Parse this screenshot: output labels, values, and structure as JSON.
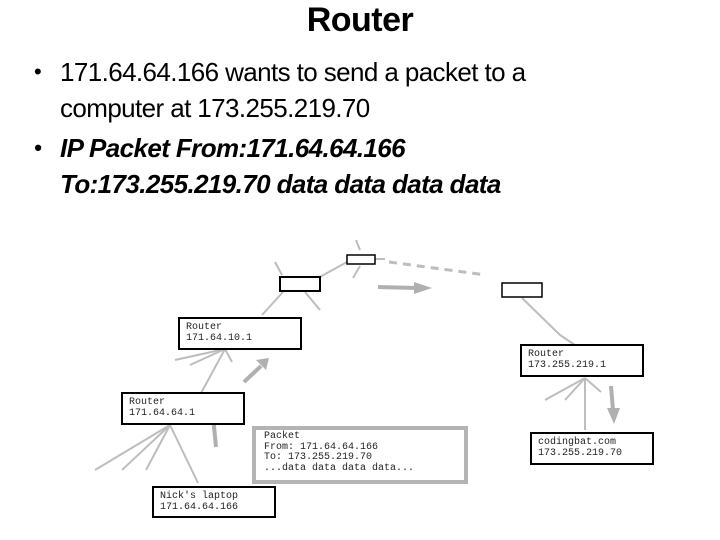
{
  "slide": {
    "title": "Router",
    "bullets": [
      {
        "text": "171.64.64.166 wants to send a packet to a",
        "text2": "computer at 173.255.219.70"
      },
      {
        "text": "IP Packet From:171.64.64.166",
        "text2": "To:173.255.219.70 data data data data"
      }
    ],
    "bullet_glyph": "•"
  },
  "diagram": {
    "nodes": {
      "router_top": {
        "label": "Router",
        "ip": "171.64.10.1"
      },
      "router_left": {
        "label": "Router",
        "ip": "171.64.64.1"
      },
      "laptop": {
        "label": "Nick's laptop",
        "ip": "171.64.64.166"
      },
      "router_right": {
        "label": "Router",
        "ip": "173.255.219.1"
      },
      "server": {
        "label": "codingbat.com",
        "ip": "173.255.219.70"
      }
    },
    "packet": {
      "line1": "Packet",
      "line2": "From: 171.64.64.166",
      "line3": "To: 173.255.219.70",
      "line4": "...data data data data..."
    },
    "colors": {
      "link": "#bdbdbd",
      "arrow": "#b0b0b0",
      "border": "#000000",
      "packet_border": "#b4b4b4"
    }
  }
}
